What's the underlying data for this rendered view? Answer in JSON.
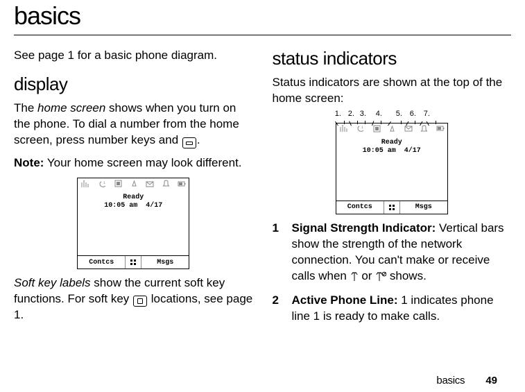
{
  "page_title": "basics",
  "col1": {
    "intro": "See page 1 for a basic phone diagram.",
    "section1_heading": "display",
    "p1_pre": "The ",
    "p1_em": "home screen",
    "p1_post": " shows when you turn on the phone. To dial a number from the home screen, press number keys and ",
    "p1_end": ".",
    "note_label": "Note:",
    "note_text": " Your home screen may look different.",
    "phone": {
      "ready": "Ready",
      "time": "10:05 am",
      "date": "4/17",
      "sk_left": "Contcs",
      "sk_right": "Msgs"
    },
    "p2_em": "Soft key labels",
    "p2_mid": " show the current soft key functions. For soft key ",
    "p2_end": " locations, see page 1."
  },
  "col2": {
    "section2_heading": "status indicators",
    "intro": "Status indicators are shown at the top of the home screen:",
    "labels": {
      "n1": "1.",
      "n2": "2.",
      "n3": "3.",
      "n4": "4.",
      "n5": "5.",
      "n6": "6.",
      "n7": "7."
    },
    "phone": {
      "ready": "Ready",
      "time": "10:05 am",
      "date": "4/17",
      "sk_left": "Contcs",
      "sk_right": "Msgs"
    },
    "items": [
      {
        "num": "1",
        "title": "Signal Strength Indicator:",
        "text_pre": " Vertical bars show the strength of the network connection. You can't make or receive calls when ",
        "text_mid": " or ",
        "text_post": " shows."
      },
      {
        "num": "2",
        "title": "Active Phone Line:",
        "text": " 1 indicates phone line 1 is ready to make calls."
      }
    ]
  },
  "footer": {
    "label": "basics",
    "page": "49"
  }
}
